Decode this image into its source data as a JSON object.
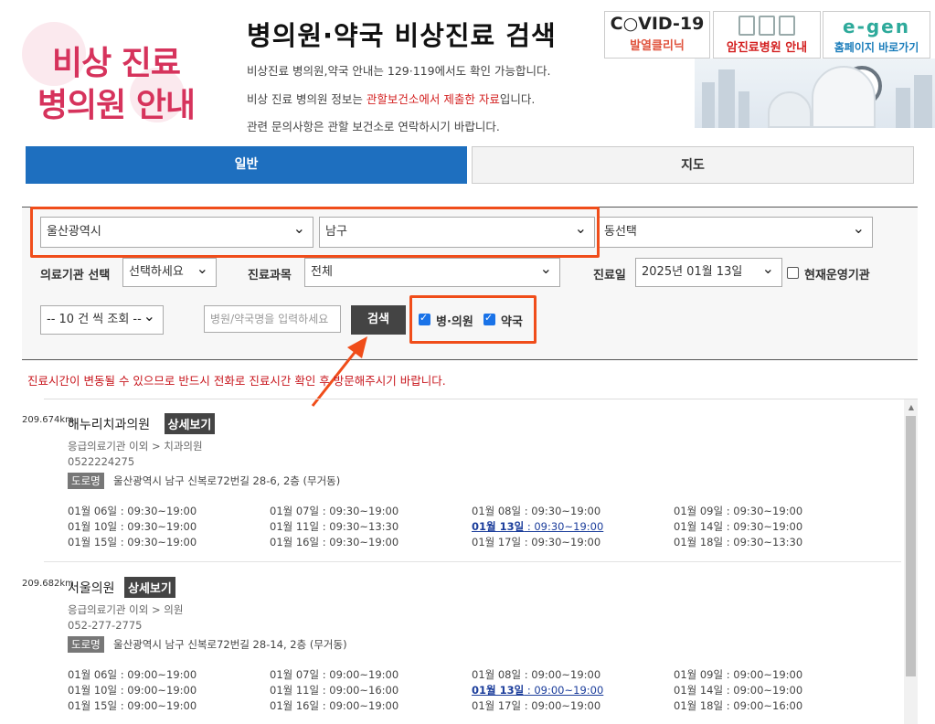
{
  "header": {
    "logo_line1": "비상 진료",
    "logo_line2": "병의원 안내",
    "title": "병의원·약국 비상진료 검색",
    "info1": "비상진료 병의원,약국 안내는 129·119에서도 확인 가능합니다.",
    "info2_pre": "비상 진료 병의원 정보는 ",
    "info2_red": "관할보건소에서 제출한 자료",
    "info2_post": "입니다.",
    "info3": "관련 문의사항은 관할 보건소로 연락하시기 바랍니다."
  },
  "banners": {
    "covid_big": "C○VID-19",
    "covid_small": "발열클리닉",
    "cancer": "암진료병원 안내",
    "home_logo": "e-gen",
    "home": "홈페이지 바로가기"
  },
  "tabs": {
    "general": "일반",
    "map": "지도"
  },
  "search": {
    "city": "울산광역시",
    "district": "남구",
    "dong": "동선택",
    "facility_label": "의료기관 선택",
    "facility_value": "선택하세요",
    "dept_label": "진료과목",
    "dept_value": "전체",
    "date_label": "진료일",
    "date_value": "2025년 01월 13일",
    "open_now": "현재운영기관",
    "per_page": "-- 10 건 씩 조회 --",
    "name_placeholder": "병원/약국명을 입력하세요",
    "search_btn": "검색",
    "chk_hospital": "병·의원",
    "chk_pharmacy": "약국"
  },
  "notice": "진료시간이 변동될 수 있으므로 반드시 전화로 진료시간 확인 후 방문해주시기 바랍니다.",
  "results": [
    {
      "distance": "209.674km",
      "name": "해누리치과의원",
      "detail": "상세보기",
      "category": "응급의료기관 이외 > 치과의원",
      "phone": "0522224275",
      "road_tag": "도로명",
      "address": "울산광역시 남구 신복로72번길 28-6, 2층 (무거동)",
      "schedule": [
        [
          "01월 06일 : 09:30~19:00",
          "01월 07일 : 09:30~19:00",
          "01월 08일 : 09:30~19:00",
          "01월 09일 : 09:30~19:00"
        ],
        [
          "01월 10일 : 09:30~19:00",
          "01월 11일 : 09:30~13:30",
          "01월 13일 : 09:30~19:00",
          "01월 14일 : 09:30~19:00"
        ],
        [
          "01월 15일 : 09:30~19:00",
          "01월 16일 : 09:30~19:00",
          "01월 17일 : 09:30~19:00",
          "01월 18일 : 09:30~13:30"
        ]
      ]
    },
    {
      "distance": "209.682km",
      "name": "서울의원",
      "detail": "상세보기",
      "category": "응급의료기관 이외 > 의원",
      "phone": "052-277-2775",
      "road_tag": "도로명",
      "address": "울산광역시 남구 신복로72번길 28-14, 2층 (무거동)",
      "schedule": [
        [
          "01월 06일 : 09:00~19:00",
          "01월 07일 : 09:00~19:00",
          "01월 08일 : 09:00~19:00",
          "01월 09일 : 09:00~19:00"
        ],
        [
          "01월 10일 : 09:00~19:00",
          "01월 11일 : 09:00~16:00",
          "01월 13일 : 09:00~19:00",
          "01월 14일 : 09:00~19:00"
        ],
        [
          "01월 15일 : 09:00~19:00",
          "01월 16일 : 09:00~19:00",
          "01월 17일 : 09:00~19:00",
          "01월 18일 : 09:00~16:00"
        ]
      ]
    }
  ],
  "colors": {
    "accent": "#1e6fbf",
    "highlight": "#f04d1a",
    "notice": "#c8161d",
    "logo": "#d6335c"
  }
}
